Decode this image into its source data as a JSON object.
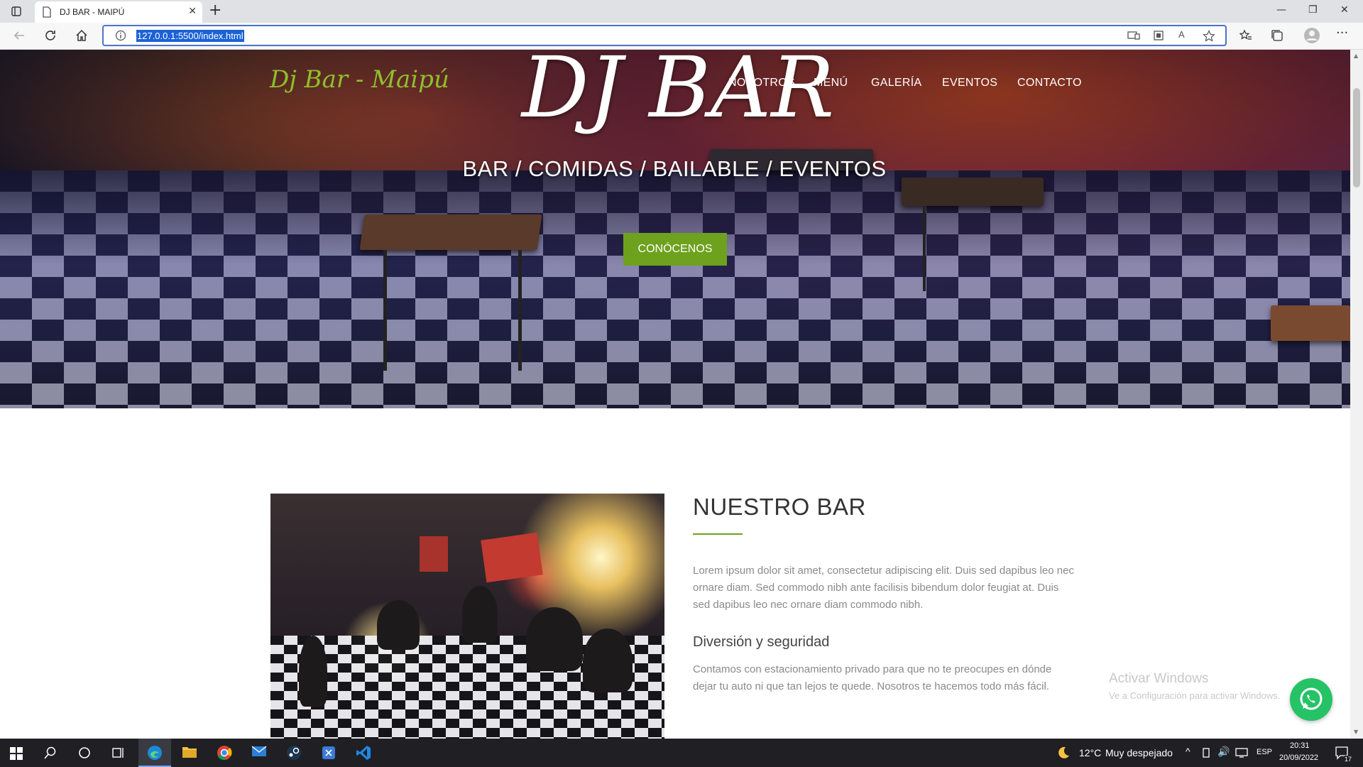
{
  "browser": {
    "tab_title": "DJ BAR - MAIPÚ",
    "url": "127.0.0.1:5500/index.html"
  },
  "site": {
    "logo": "Dj Bar - Maipú",
    "nav": [
      "NOSOTROS",
      "MENÚ",
      "GALERÍA",
      "EVENTOS",
      "CONTACTO"
    ],
    "hero_title": "DJ BAR",
    "hero_subtitle": "BAR / COMIDAS / BAILABLE / EVENTOS",
    "cta_label": "CONÓCENOS"
  },
  "about": {
    "title": "NUESTRO BAR",
    "paragraph1": "Lorem ipsum dolor sit amet, consectetur adipiscing elit. Duis sed dapibus leo nec ornare diam. Sed commodo nibh ante facilisis bibendum dolor feugiat at. Duis sed dapibus leo nec ornare diam commodo nibh.",
    "subtitle": "Diversión y seguridad",
    "paragraph2": "Contamos con estacionamiento privado para que no te preocupes en dónde dejar tu auto ni que tan lejos te quede. Nosotros te hacemos todo más fácil."
  },
  "watermark": {
    "line1": "Activar Windows",
    "line2": "Ve a Configuración para activar Windows."
  },
  "taskbar": {
    "weather_temp": "12°C",
    "weather_text": "Muy despejado",
    "language": "ESP",
    "time": "20:31",
    "date": "20/09/2022",
    "notification_count": "17"
  },
  "colors": {
    "accent_green": "#6ea11e",
    "logo_green": "#8fbf2c",
    "whatsapp_green": "#25c366"
  },
  "icons": [
    "tabs-icon",
    "page-icon",
    "close-icon",
    "plus-icon",
    "minimize-icon",
    "restore-icon",
    "window-close-icon",
    "back-icon",
    "refresh-icon",
    "home-icon",
    "info-icon",
    "read-aloud-icon",
    "favorite-icon",
    "favorites-icon",
    "collections-icon",
    "profile-icon",
    "more-icon",
    "whatsapp-icon",
    "windows-start-icon",
    "search-icon",
    "cortana-icon",
    "task-view-icon",
    "edge-icon",
    "folder-icon",
    "chrome-icon",
    "mail-icon",
    "steam-icon",
    "vscode-icon",
    "moon-icon"
  ]
}
